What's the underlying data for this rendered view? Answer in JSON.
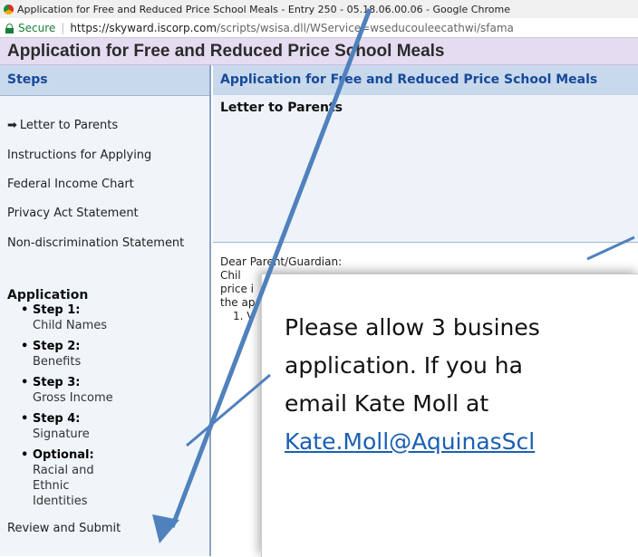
{
  "browser": {
    "window_title": "Application for Free and Reduced Price School Meals - Entry 250 - 05.18.06.00.06 - Google Chrome",
    "secure_label": "Secure",
    "url_host": "https://skyward.iscorp.com",
    "url_rest": "/scripts/wsisa.dll/WService=wseducouleecathwi/sfama"
  },
  "app": {
    "header_title": "Application for Free and Reduced Price School Meals"
  },
  "sidebar": {
    "heading": "Steps",
    "arrow": "➡",
    "items": [
      "Letter to Parents",
      "Instructions for Applying",
      "Federal Income Chart",
      "Privacy Act Statement",
      "Non-discrimination Statement"
    ],
    "section": "Application",
    "steps": [
      {
        "title": "Step 1:",
        "desc": "Child Names"
      },
      {
        "title": "Step 2:",
        "desc": "Benefits"
      },
      {
        "title": "Step 3:",
        "desc": "Gross Income"
      },
      {
        "title": "Step 4:",
        "desc": "Signature"
      },
      {
        "title": "Optional:",
        "desc": "Racial and Ethnic Identities"
      }
    ],
    "review": "Review and Submit"
  },
  "main": {
    "heading": "Application for Free and Reduced Price School Meals",
    "letter_title": "Letter to Parents",
    "letter_lines": [
      "Dear Parent/Guardian:",
      "Chil",
      "price i",
      "the ap",
      "1. V"
    ]
  },
  "popup": {
    "line1": "Please allow 3 busines",
    "line2": "application.  If you ha",
    "line3": "email Kate Moll at",
    "link": "Kate.Moll@AquinasScl"
  },
  "colors": {
    "arrow": "#4f81bd",
    "header_bg": "#e6dcf2",
    "panel_head": "#c9d9ec",
    "link": "#1a5fb4"
  }
}
